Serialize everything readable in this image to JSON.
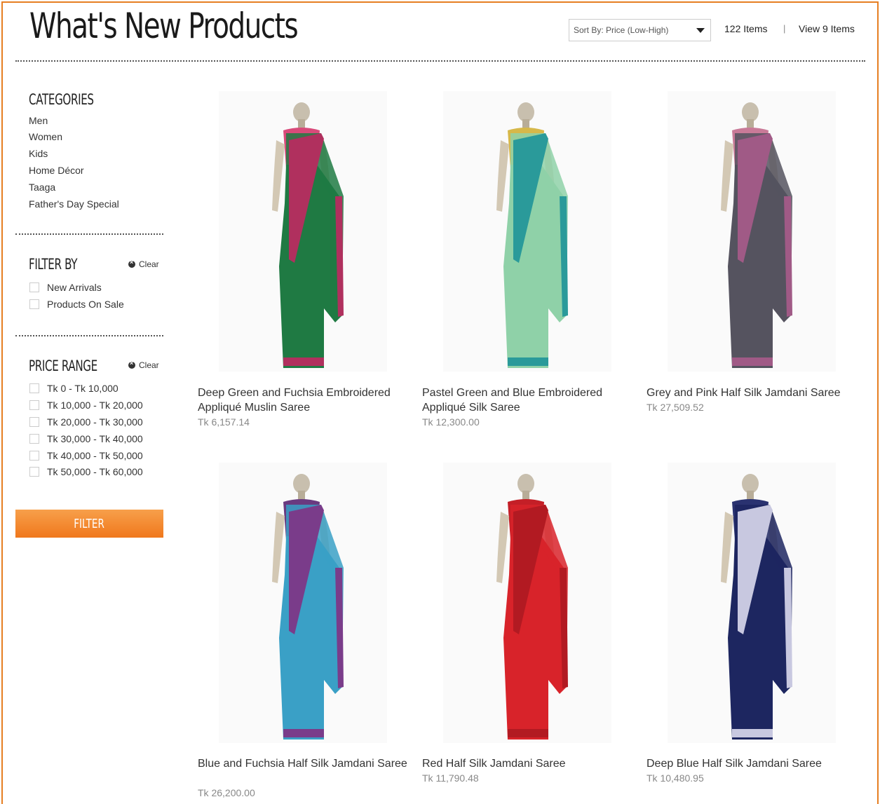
{
  "header": {
    "title": "What's New Products",
    "sort_label": "Sort By: Price (Low-High)",
    "items_count": "122 Items",
    "separator": "|",
    "view_label": "View 9 Items"
  },
  "sidebar": {
    "categories_heading": "CATEGORIES",
    "categories": [
      "Men",
      "Women",
      "Kids",
      "Home Décor",
      "Taaga",
      "Father's Day Special"
    ],
    "filter_heading": "FILTER BY",
    "clear_label": "Clear",
    "filters": [
      "New Arrivals",
      "Products On Sale"
    ],
    "price_heading": "PRICE RANGE",
    "prices": [
      "Tk 0 - Tk 10,000",
      "Tk 10,000 - Tk 20,000",
      "Tk 20,000 - Tk 30,000",
      "Tk 30,000 - Tk 40,000",
      "Tk 40,000 - Tk 50,000",
      "Tk 50,000 - Tk 60,000"
    ],
    "filter_button": "FILTER"
  },
  "products": [
    {
      "name": "Deep Green and Fuchsia Embroidered Appliqué Muslin Saree",
      "price": "Tk 6,157.14",
      "colors": {
        "main": "#1f7a43",
        "border": "#b0305e",
        "blouse": "#d94a7a"
      }
    },
    {
      "name": "Pastel Green and Blue Embroidered Appliqué Silk Saree",
      "price": "Tk 12,300.00",
      "colors": {
        "main": "#8fd1a8",
        "border": "#2a9a9a",
        "blouse": "#d6b84a"
      }
    },
    {
      "name": "Grey and Pink Half Silk Jamdani Saree",
      "price": "Tk 27,509.52",
      "colors": {
        "main": "#55535f",
        "border": "#a05a86",
        "blouse": "#c97a98"
      }
    },
    {
      "name": "Blue and Fuchsia Half Silk Jamdani Saree",
      "price": "Tk 26,200.00",
      "colors": {
        "main": "#3aa0c6",
        "border": "#7a3c8a",
        "blouse": "#6a3a80"
      }
    },
    {
      "name": "Red Half Silk Jamdani Saree",
      "price": "Tk 11,790.48",
      "colors": {
        "main": "#d8232a",
        "border": "#b21a22",
        "blouse": "#c41f27"
      }
    },
    {
      "name": "Deep Blue Half Silk Jamdani Saree",
      "price": "Tk 10,480.95",
      "colors": {
        "main": "#1d2660",
        "border": "#c8c8e0",
        "blouse": "#2a3270"
      }
    }
  ]
}
